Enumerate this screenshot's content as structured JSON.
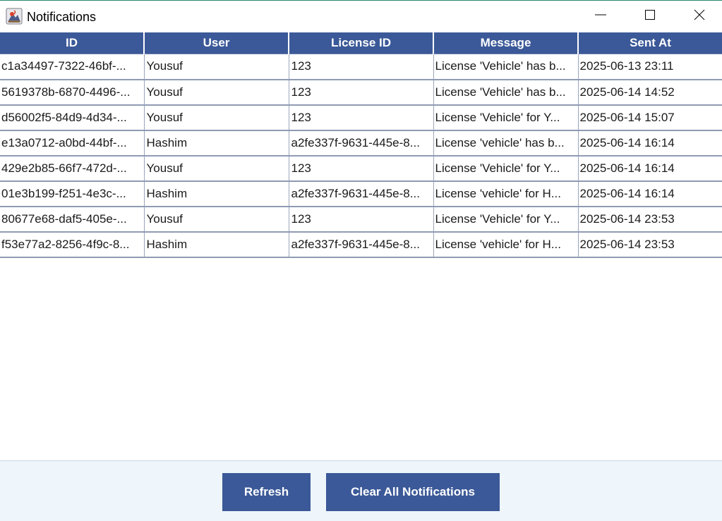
{
  "window": {
    "title": "Notifications"
  },
  "icons": {
    "app": "java-app-icon",
    "minimize": "minimize-icon",
    "maximize": "maximize-icon",
    "close": "close-icon"
  },
  "table": {
    "columns": [
      "ID",
      "User",
      "License ID",
      "Message",
      "Sent At"
    ],
    "rows": [
      [
        "c1a34497-7322-46bf-...",
        "Yousuf",
        "123",
        "License 'Vehicle' has b...",
        "2025-06-13 23:11"
      ],
      [
        "5619378b-6870-4496-...",
        "Yousuf",
        "123",
        "License 'Vehicle' has b...",
        "2025-06-14 14:52"
      ],
      [
        "d56002f5-84d9-4d34-...",
        "Yousuf",
        "123",
        "License 'Vehicle' for Y...",
        "2025-06-14 15:07"
      ],
      [
        "e13a0712-a0bd-44bf-...",
        "Hashim",
        "a2fe337f-9631-445e-8...",
        "License 'vehicle' has b...",
        "2025-06-14 16:14"
      ],
      [
        "429e2b85-66f7-472d-...",
        "Yousuf",
        "123",
        "License 'Vehicle' for Y...",
        "2025-06-14 16:14"
      ],
      [
        "01e3b199-f251-4e3c-...",
        "Hashim",
        "a2fe337f-9631-445e-8...",
        "License 'vehicle' for H...",
        "2025-06-14 16:14"
      ],
      [
        "80677e68-daf5-405e-...",
        "Yousuf",
        "123",
        "License 'Vehicle' for Y...",
        "2025-06-14 23:53"
      ],
      [
        "f53e77a2-8256-4f9c-8...",
        "Hashim",
        "a2fe337f-9631-445e-8...",
        "License 'vehicle' for H...",
        "2025-06-14 23:53"
      ]
    ]
  },
  "buttons": {
    "refresh": "Refresh",
    "clear_all": "Clear All Notifications"
  },
  "colors": {
    "header_bg": "#3b5998",
    "button_bg": "#3b5998",
    "panel_bg": "#eef6fb"
  }
}
